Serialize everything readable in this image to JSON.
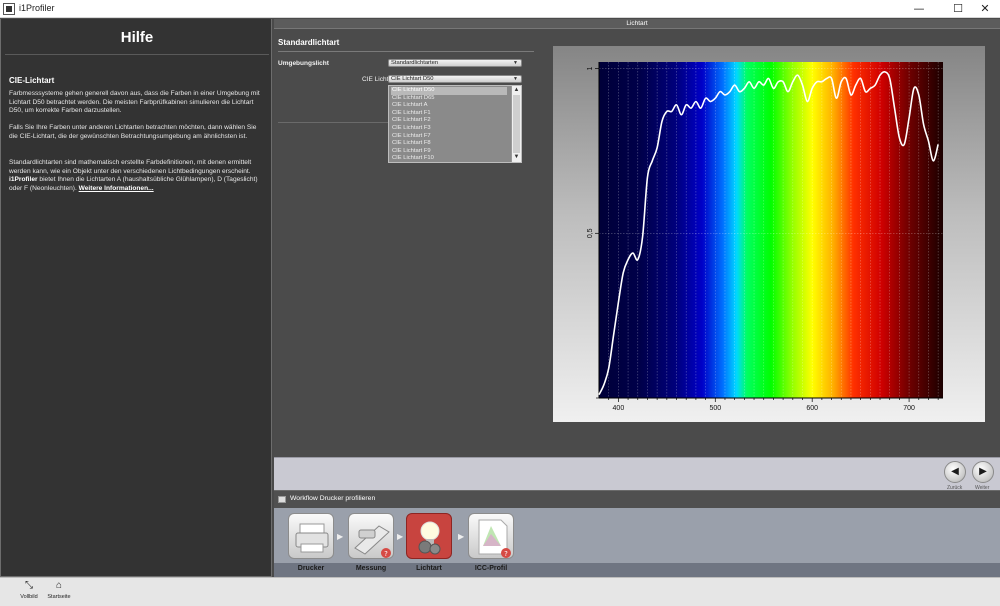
{
  "window": {
    "title": "i1Profiler",
    "controls": {
      "minimize": "—",
      "maximize": "☐",
      "close": "✕"
    }
  },
  "help": {
    "title": "Hilfe",
    "heading": "CIE-Lichtart",
    "p1": "Farbmesssysteme gehen generell davon aus, dass die Farben in einer Umgebung mit Lichtart D50 betrachtet werden. Die meisten Farbprüfkabinen simulieren die Lichtart D50, um korrekte Farben darzustellen.",
    "p2": "Falls Sie Ihre Farben unter anderen Lichtarten betrachten möchten, dann wählen Sie die CIE-Lichtart, die der gewünschten Betrachtungsumgebung am ähnlichsten ist.",
    "p3_a": "Standardlichtarten sind mathematisch erstellte Farbdefinitionen, mit denen ermittelt werden kann, wie ein Objekt unter den verschiedenen Lichtbedingungen erscheint. ",
    "p3_b": "i1Profiler",
    "p3_c": " bietet Ihnen die Lichtarten A (haushaltsübliche Glühlampen), D (Tageslicht) oder F (Neonleuchten). ",
    "p3_link": "Weitere Informationen..."
  },
  "main": {
    "header": "Lichtart",
    "section_title": "Standardlichtart",
    "ambient_label": "Umgebungslicht",
    "ambient_value": "Standardlichtarten",
    "cie_label": "CIE Lichtart:",
    "cie_value": "CIE Lichtart D50",
    "cie_options": [
      "CIE Lichtart D50",
      "CIE Lichtart D65",
      "CIE Lichtart A",
      "CIE Lichtart F1",
      "CIE Lichtart F2",
      "CIE Lichtart F3",
      "CIE Lichtart F7",
      "CIE Lichtart F8",
      "CIE Lichtart F9",
      "CIE Lichtart F10"
    ],
    "selected_option": 0,
    "arrow_down": "▼",
    "scroll_up": "▲",
    "scroll_down": "▼"
  },
  "chart_data": {
    "type": "line",
    "title": "",
    "xlabel": "",
    "ylabel": "",
    "xlim": [
      380,
      735
    ],
    "ylim": [
      0,
      1.02
    ],
    "x_ticks": [
      "400",
      "500",
      "600",
      "700"
    ],
    "y_ticks": [
      "1",
      "0,5"
    ],
    "grid": true,
    "series": [
      {
        "name": "",
        "color": "#ffffff",
        "x": [
          380,
          385,
          390,
          395,
          400,
          405,
          410,
          415,
          420,
          425,
          430,
          435,
          440,
          445,
          450,
          455,
          460,
          465,
          470,
          475,
          480,
          485,
          490,
          495,
          500,
          505,
          510,
          515,
          520,
          525,
          530,
          535,
          540,
          545,
          550,
          555,
          560,
          565,
          570,
          575,
          580,
          585,
          590,
          595,
          600,
          605,
          610,
          615,
          620,
          625,
          630,
          635,
          640,
          645,
          650,
          655,
          660,
          665,
          670,
          675,
          680,
          685,
          690,
          695,
          700,
          705,
          710,
          715,
          720,
          725,
          730
        ],
        "y": [
          0.01,
          0.04,
          0.09,
          0.19,
          0.29,
          0.38,
          0.42,
          0.44,
          0.42,
          0.49,
          0.67,
          0.72,
          0.76,
          0.84,
          0.87,
          0.87,
          0.89,
          0.86,
          0.89,
          0.88,
          0.9,
          0.88,
          0.91,
          0.9,
          0.91,
          0.93,
          0.92,
          0.93,
          0.95,
          0.93,
          0.94,
          0.96,
          0.94,
          0.96,
          0.95,
          0.97,
          0.94,
          0.96,
          0.96,
          0.93,
          0.96,
          0.98,
          0.95,
          0.9,
          0.94,
          0.96,
          0.96,
          0.97,
          0.97,
          0.91,
          0.96,
          0.97,
          0.92,
          0.95,
          0.97,
          0.93,
          0.94,
          0.95,
          0.98,
          0.99,
          0.97,
          0.88,
          0.79,
          0.77,
          0.85,
          0.94,
          0.92,
          0.83,
          0.78,
          0.72,
          0.77
        ]
      }
    ]
  },
  "nav": {
    "back_label": "Zurück",
    "next_label": "Weiter",
    "back_icon": "◀",
    "next_icon": "▶"
  },
  "workflow": {
    "title": "Workflow Drucker profilieren",
    "steps": [
      {
        "label": "Drucker",
        "icon": "printer-icon"
      },
      {
        "label": "Messung",
        "icon": "measurement-icon"
      },
      {
        "label": "Lichtart",
        "icon": "lightbulb-icon"
      },
      {
        "label": "ICC-Profil",
        "icon": "icc-profile-icon"
      }
    ],
    "active_step": 2
  },
  "bottom": {
    "fullscreen_label": "Vollbild",
    "home_label": "Startseite",
    "fullscreen_icon": "⤡",
    "home_icon": "⌂"
  }
}
